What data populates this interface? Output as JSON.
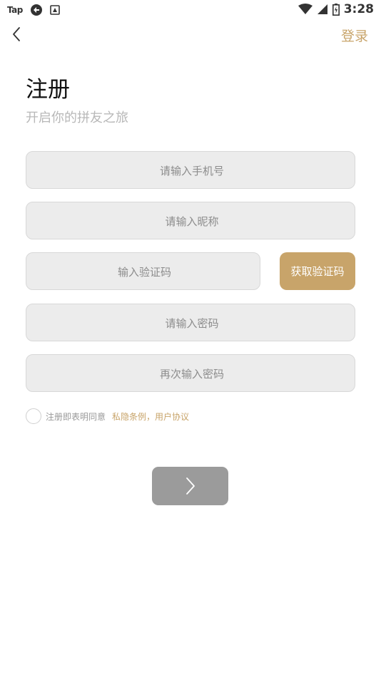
{
  "status_bar": {
    "app_label": "Tap",
    "time": "3:28"
  },
  "nav": {
    "back_icon": "chevron-left-icon",
    "login_label": "登录"
  },
  "header": {
    "title": "注册",
    "subtitle": "开启你的拼友之旅"
  },
  "form": {
    "phone_placeholder": "请输入手机号",
    "nickname_placeholder": "请输入昵称",
    "code_placeholder": "输入验证码",
    "get_code_label": "获取验证码",
    "password_placeholder": "请输入密码",
    "confirm_password_placeholder": "再次输入密码"
  },
  "agreement": {
    "checked": false,
    "text": "注册即表明同意",
    "link_text": "私隐条例，用户协议"
  },
  "submit": {
    "icon": "chevron-right-icon"
  },
  "colors": {
    "accent": "#c8a46a",
    "field_bg": "#ececec",
    "button_disabled": "#9b9b9b"
  }
}
